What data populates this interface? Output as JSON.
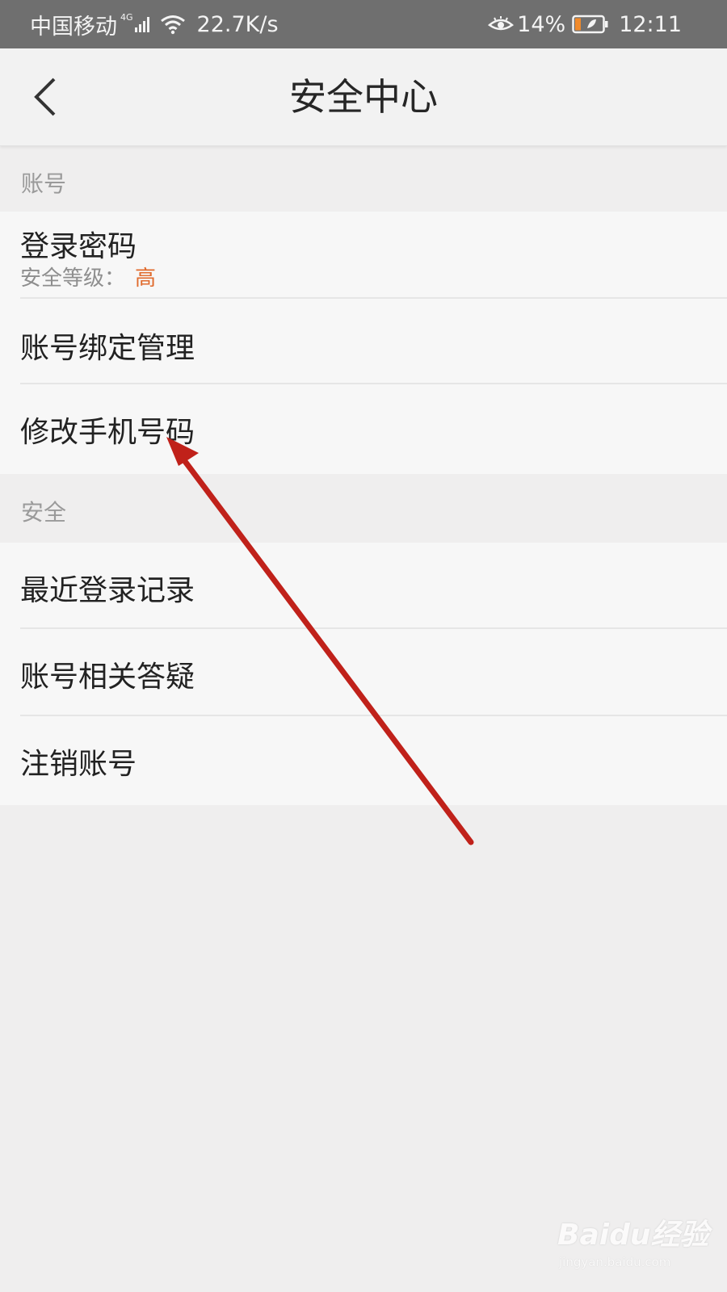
{
  "status_bar": {
    "carrier": "中国移动",
    "network_type": "4G",
    "network_speed": "22.7K/s",
    "battery_percent": "14%",
    "time": "12:11",
    "icons": [
      "signal-icon",
      "wifi-icon",
      "eye-care-icon",
      "battery-icon"
    ]
  },
  "nav": {
    "title": "安全中心",
    "back_icon": "chevron-left-icon"
  },
  "sections": [
    {
      "header": "账号",
      "items": [
        {
          "label": "登录密码",
          "sub_label": "安全等级：",
          "sub_value": "高"
        },
        {
          "label": "账号绑定管理"
        },
        {
          "label": "修改手机号码"
        }
      ]
    },
    {
      "header": "安全",
      "items": [
        {
          "label": "最近登录记录"
        },
        {
          "label": "账号相关答疑"
        },
        {
          "label": "注销账号"
        }
      ]
    }
  ],
  "watermark": {
    "logo": "Baidu经验",
    "url": "jingyan.baidu.com"
  },
  "colors": {
    "accent_orange": "#e06a2c",
    "annotation_arrow": "#c0211a",
    "status_bar_bg": "#6f6f6f",
    "page_bg": "#efeeee"
  }
}
